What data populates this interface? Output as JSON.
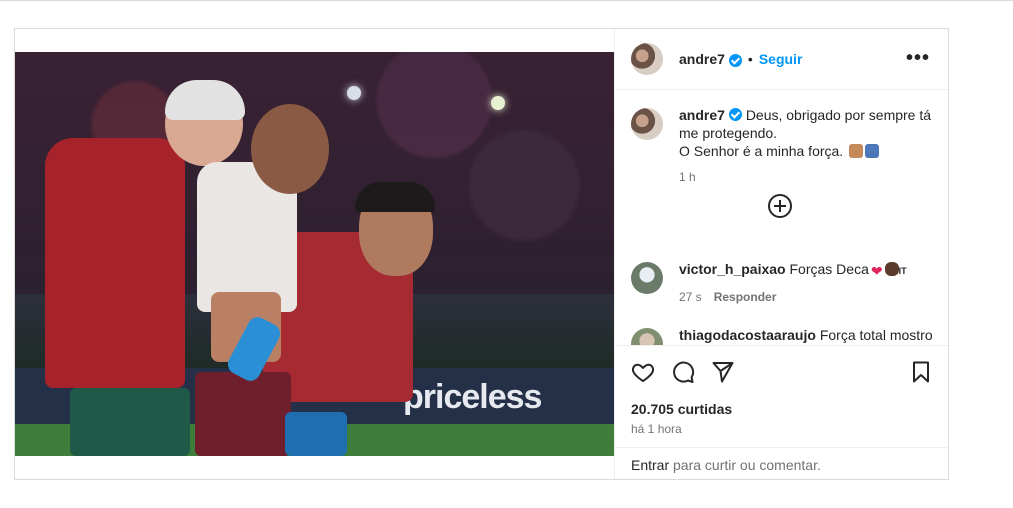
{
  "post": {
    "author": "andre7",
    "follow_label": "Seguir",
    "separator": "•",
    "more_label": "•••",
    "caption_line1": "Deus, obrigado por sempre tá me protegendo.",
    "caption_line2": "O Senhor é a minha força.",
    "caption_time": "1 h",
    "photo_ad_text": "priceless",
    "likes": "20.705 curtidas",
    "posted": "há 1 hora"
  },
  "comments": [
    {
      "user": "victor_h_paixao",
      "text": "Forças Deca",
      "suffix": "IT",
      "time": "27 s",
      "reply_label": "Responder"
    },
    {
      "user": "thiagodacostaaraujo",
      "text": "Força total mostro"
    }
  ],
  "login": {
    "link": "Entrar",
    "rest": "para curtir ou comentar."
  },
  "icons": {
    "like": "heart-icon",
    "comment": "comment-icon",
    "share": "send-icon",
    "save": "bookmark-icon",
    "load_more": "plus-circle-icon"
  },
  "colors": {
    "accent": "#0095f6",
    "text": "#262626",
    "muted": "#737373"
  }
}
